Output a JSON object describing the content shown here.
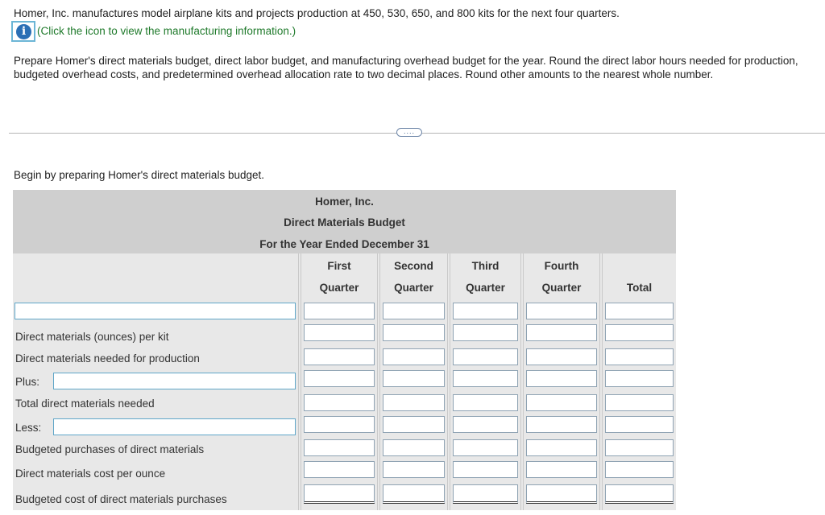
{
  "problem": {
    "intro": "Homer, Inc. manufactures model airplane kits and projects production at 450, 530, 650, and 800 kits for the next four quarters.",
    "info_link": "(Click the icon to view the manufacturing information.)",
    "instructions": "Prepare Homer's direct materials budget, direct labor budget, and manufacturing overhead budget for the year. Round the direct labor hours needed for production, budgeted overhead costs, and predetermined overhead allocation rate to two decimal places. Round other amounts to the nearest whole number.",
    "more_button": "....",
    "begin": "Begin by preparing Homer's direct materials budget."
  },
  "budget": {
    "company": "Homer, Inc.",
    "title": "Direct Materials Budget",
    "period": "For the Year Ended December 31",
    "columns": [
      {
        "top": "First",
        "bottom": "Quarter"
      },
      {
        "top": "Second",
        "bottom": "Quarter"
      },
      {
        "top": "Third",
        "bottom": "Quarter"
      },
      {
        "top": "Fourth",
        "bottom": "Quarter"
      },
      {
        "top": "",
        "bottom": "Total"
      }
    ],
    "rows": {
      "first_row_value": "",
      "dm_per_kit": "Direct materials (ounces) per kit",
      "dm_needed": "Direct materials needed for production",
      "plus": "Plus:",
      "plus_value": "",
      "total_needed": "Total direct materials needed",
      "less": "Less:",
      "less_value": "",
      "budgeted_purchases": "Budgeted purchases of direct materials",
      "cost_per_ounce": "Direct materials cost per ounce",
      "budgeted_cost": "Budgeted cost of direct materials purchases"
    }
  }
}
